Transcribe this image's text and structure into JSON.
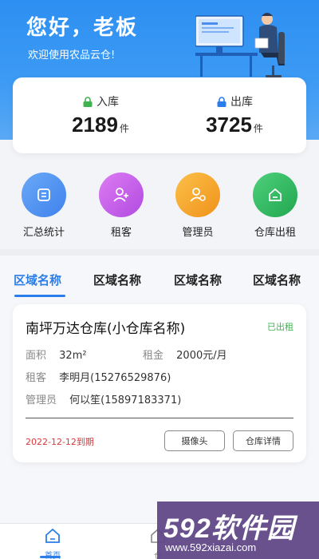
{
  "header": {
    "greeting": "您好，老板",
    "welcome": "欢迎使用农品云仓!"
  },
  "stats": {
    "in_label": "入库",
    "in_value": "2189",
    "in_unit": "件",
    "out_label": "出库",
    "out_value": "3725",
    "out_unit": "件"
  },
  "quick_actions": [
    {
      "label": "汇总统计",
      "icon": "summary-icon",
      "color": "#4a8ff0"
    },
    {
      "label": "租客",
      "icon": "add-user-icon",
      "color": "#c55ae6"
    },
    {
      "label": "管理员",
      "icon": "admin-icon",
      "color": "#f4a21f"
    },
    {
      "label": "仓库出租",
      "icon": "warehouse-icon",
      "color": "#29b35a"
    }
  ],
  "tabs": [
    {
      "label": "区域名称",
      "active": true
    },
    {
      "label": "区域名称",
      "active": false
    },
    {
      "label": "区域名称",
      "active": false
    },
    {
      "label": "区域名称",
      "active": false
    }
  ],
  "warehouse": {
    "title": "南坪万达仓库(小仓库名称)",
    "status": "已出租",
    "area_label": "面积",
    "area_value": "32m²",
    "rent_label": "租金",
    "rent_value": "2000元/月",
    "tenant_label": "租客",
    "tenant_value": "李明月(15276529876)",
    "admin_label": "管理员",
    "admin_value": "何以笙(15897183371)",
    "due": "2022-12-12到期",
    "camera_button": "摄像头",
    "detail_button": "仓库详情"
  },
  "bottom_nav": [
    {
      "label": "首页",
      "icon": "home-icon",
      "active": true
    },
    {
      "label": "仓",
      "icon": "warehouse-icon",
      "active": false
    }
  ],
  "watermark": {
    "brand": "592软件园",
    "url": "www.592xiazai.com"
  },
  "colors": {
    "primary": "#2b7de9",
    "header": "#3d9bf4",
    "status_green": "#3fb34f",
    "due_red": "#d9383a"
  }
}
